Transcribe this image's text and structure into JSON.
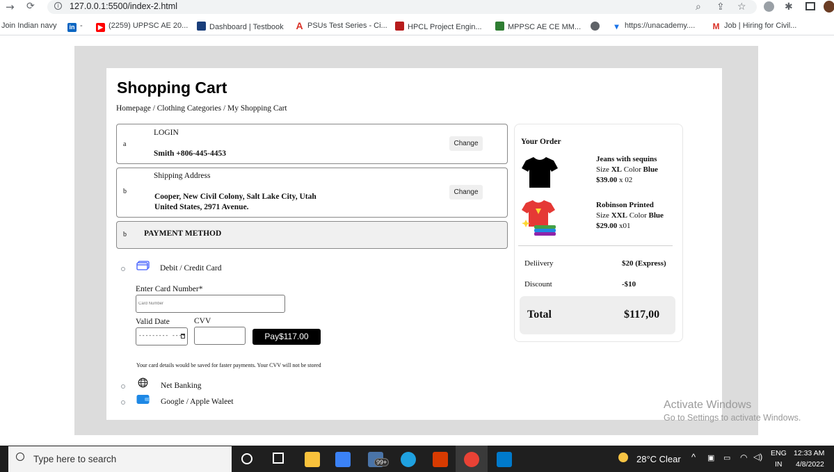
{
  "browser": {
    "url": "127.0.0.1:5500/index-2.html",
    "bookmarks": [
      "Join Indian navy",
      "-",
      "(2259) UPPSC AE 20...",
      "Dashboard | Testbook",
      "PSUs Test Series - Ci...",
      "HPCL Project Engin...",
      "MPPSC AE CE MM...",
      "https://unacademy....",
      "Job | Hiring for Civil..."
    ]
  },
  "page": {
    "title": "Shopping Cart",
    "breadcrumb": "Homepage / Clothing Categories / My Shopping Cart"
  },
  "login": {
    "marker": "a",
    "heading": "LOGIN",
    "value": "Smith +806-445-4453",
    "change_label": "Change"
  },
  "shipping": {
    "marker": "b",
    "heading": "Shipping Address",
    "line1": "Cooper, New Civil Colony, Salt Lake City, Utah",
    "line2": "United States, 2971 Avenue.",
    "change_label": "Change"
  },
  "payment": {
    "marker": "b",
    "heading": "PAYMENT METHOD",
    "options": {
      "card": "Debit / Credit Card",
      "netbanking": "Net Banking",
      "wallet": "Google / Apple Waleet"
    },
    "card_number_label": "Enter Card Number*",
    "card_number_placeholder": "Card Number",
    "valid_date_label": "Valid Date",
    "valid_date_placeholder": "--------- ----",
    "cvv_label": "CVV",
    "pay_button": "Pay$117.00",
    "note": "Your card details would be saved for faster payments. Your CVV will not be stored"
  },
  "order": {
    "heading": "Your Order",
    "items": [
      {
        "name": "Jeans with sequins",
        "size_label": "Size",
        "size": "XL",
        "color_label": "Color",
        "color": "Blue",
        "price": "$39.00",
        "qty": "x 02"
      },
      {
        "name": "Robinson Printed",
        "size_label": "Size",
        "size": "XXL",
        "color_label": "Color",
        "color": "Blue",
        "price": "$29.00",
        "qty": "x01"
      }
    ],
    "delivery_label": "Deliivery",
    "delivery_value": "$20 (Express)",
    "discount_label": "Discount",
    "discount_value": "-$10",
    "total_label": "Total",
    "total_value": "$117,00"
  },
  "windows_watermark": {
    "title": "Activate Windows",
    "subtitle": "Go to Settings to activate Windows."
  },
  "taskbar": {
    "search_placeholder": "Type here to search",
    "mail_badge": "99+",
    "weather": "28°C  Clear",
    "language": "ENG",
    "region": "IN",
    "time": "12:33 AM",
    "date": "4/8/2022"
  },
  "colors": {
    "pay_button_bg": "#000000",
    "page_frame": "#dcdcdc",
    "total_box_bg": "#eeeeee"
  }
}
